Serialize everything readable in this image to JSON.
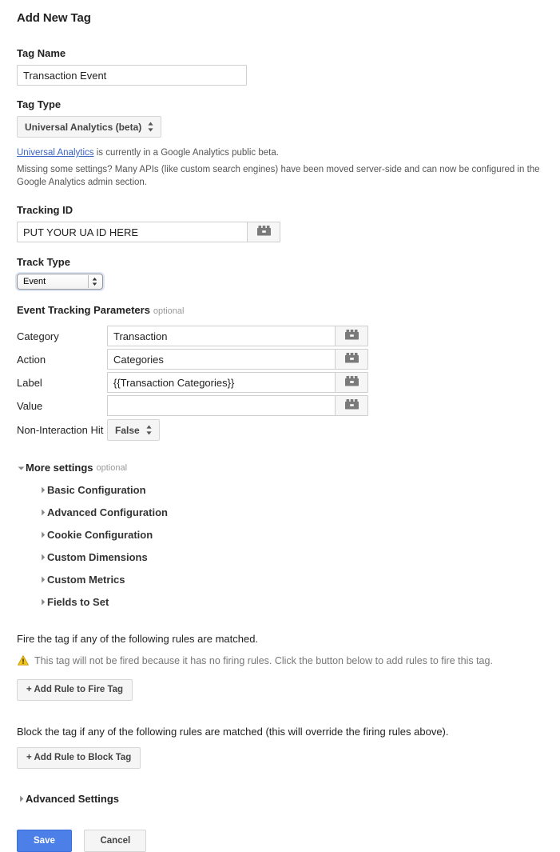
{
  "page": {
    "title": "Add New Tag"
  },
  "tag_name": {
    "label": "Tag Name",
    "value": "Transaction Event"
  },
  "tag_type": {
    "label": "Tag Type",
    "selected": "Universal Analytics (beta)",
    "note_link": "Universal Analytics",
    "note_rest": " is currently in a Google Analytics public beta.",
    "note2": "Missing some settings? Many APIs (like custom search engines) have been moved server-side and can now be configured in the Google Analytics admin section."
  },
  "tracking_id": {
    "label": "Tracking ID",
    "value": "PUT YOUR UA ID HERE",
    "picker_icon": "variable-brick-icon"
  },
  "track_type": {
    "label": "Track Type",
    "selected": "Event"
  },
  "event_params": {
    "heading": "Event Tracking Parameters",
    "optional": "optional",
    "rows": [
      {
        "label": "Category",
        "value": "Transaction"
      },
      {
        "label": "Action",
        "value": "Categories"
      },
      {
        "label": "Label",
        "value": "{{Transaction Categories}}"
      },
      {
        "label": "Value",
        "value": ""
      }
    ],
    "non_interaction": {
      "label": "Non-Interaction Hit",
      "selected": "False"
    }
  },
  "more_settings": {
    "label": "More settings",
    "optional": "optional",
    "expanded": true,
    "items": [
      {
        "label": "Basic Configuration"
      },
      {
        "label": "Advanced Configuration"
      },
      {
        "label": "Cookie Configuration"
      },
      {
        "label": "Custom Dimensions"
      },
      {
        "label": "Custom Metrics"
      },
      {
        "label": "Fields to Set"
      }
    ]
  },
  "firing_rules": {
    "text": "Fire the tag if any of the following rules are matched.",
    "warning": "This tag will not be fired because it has no firing rules. Click the button below to add rules to fire this tag.",
    "warning_icon": "warning-triangle-icon",
    "button": "+ Add Rule to Fire Tag"
  },
  "blocking_rules": {
    "text": "Block the tag if any of the following rules are matched (this will override the firing rules above).",
    "button": "+ Add Rule to Block Tag"
  },
  "advanced_settings": {
    "label": "Advanced Settings"
  },
  "footer": {
    "save": "Save",
    "cancel": "Cancel"
  },
  "colors": {
    "accent_blue": "#4d7fe8",
    "link_blue": "#3b63c4",
    "warning_amber": "#f0c419",
    "text": "#222222",
    "muted": "#777777"
  }
}
